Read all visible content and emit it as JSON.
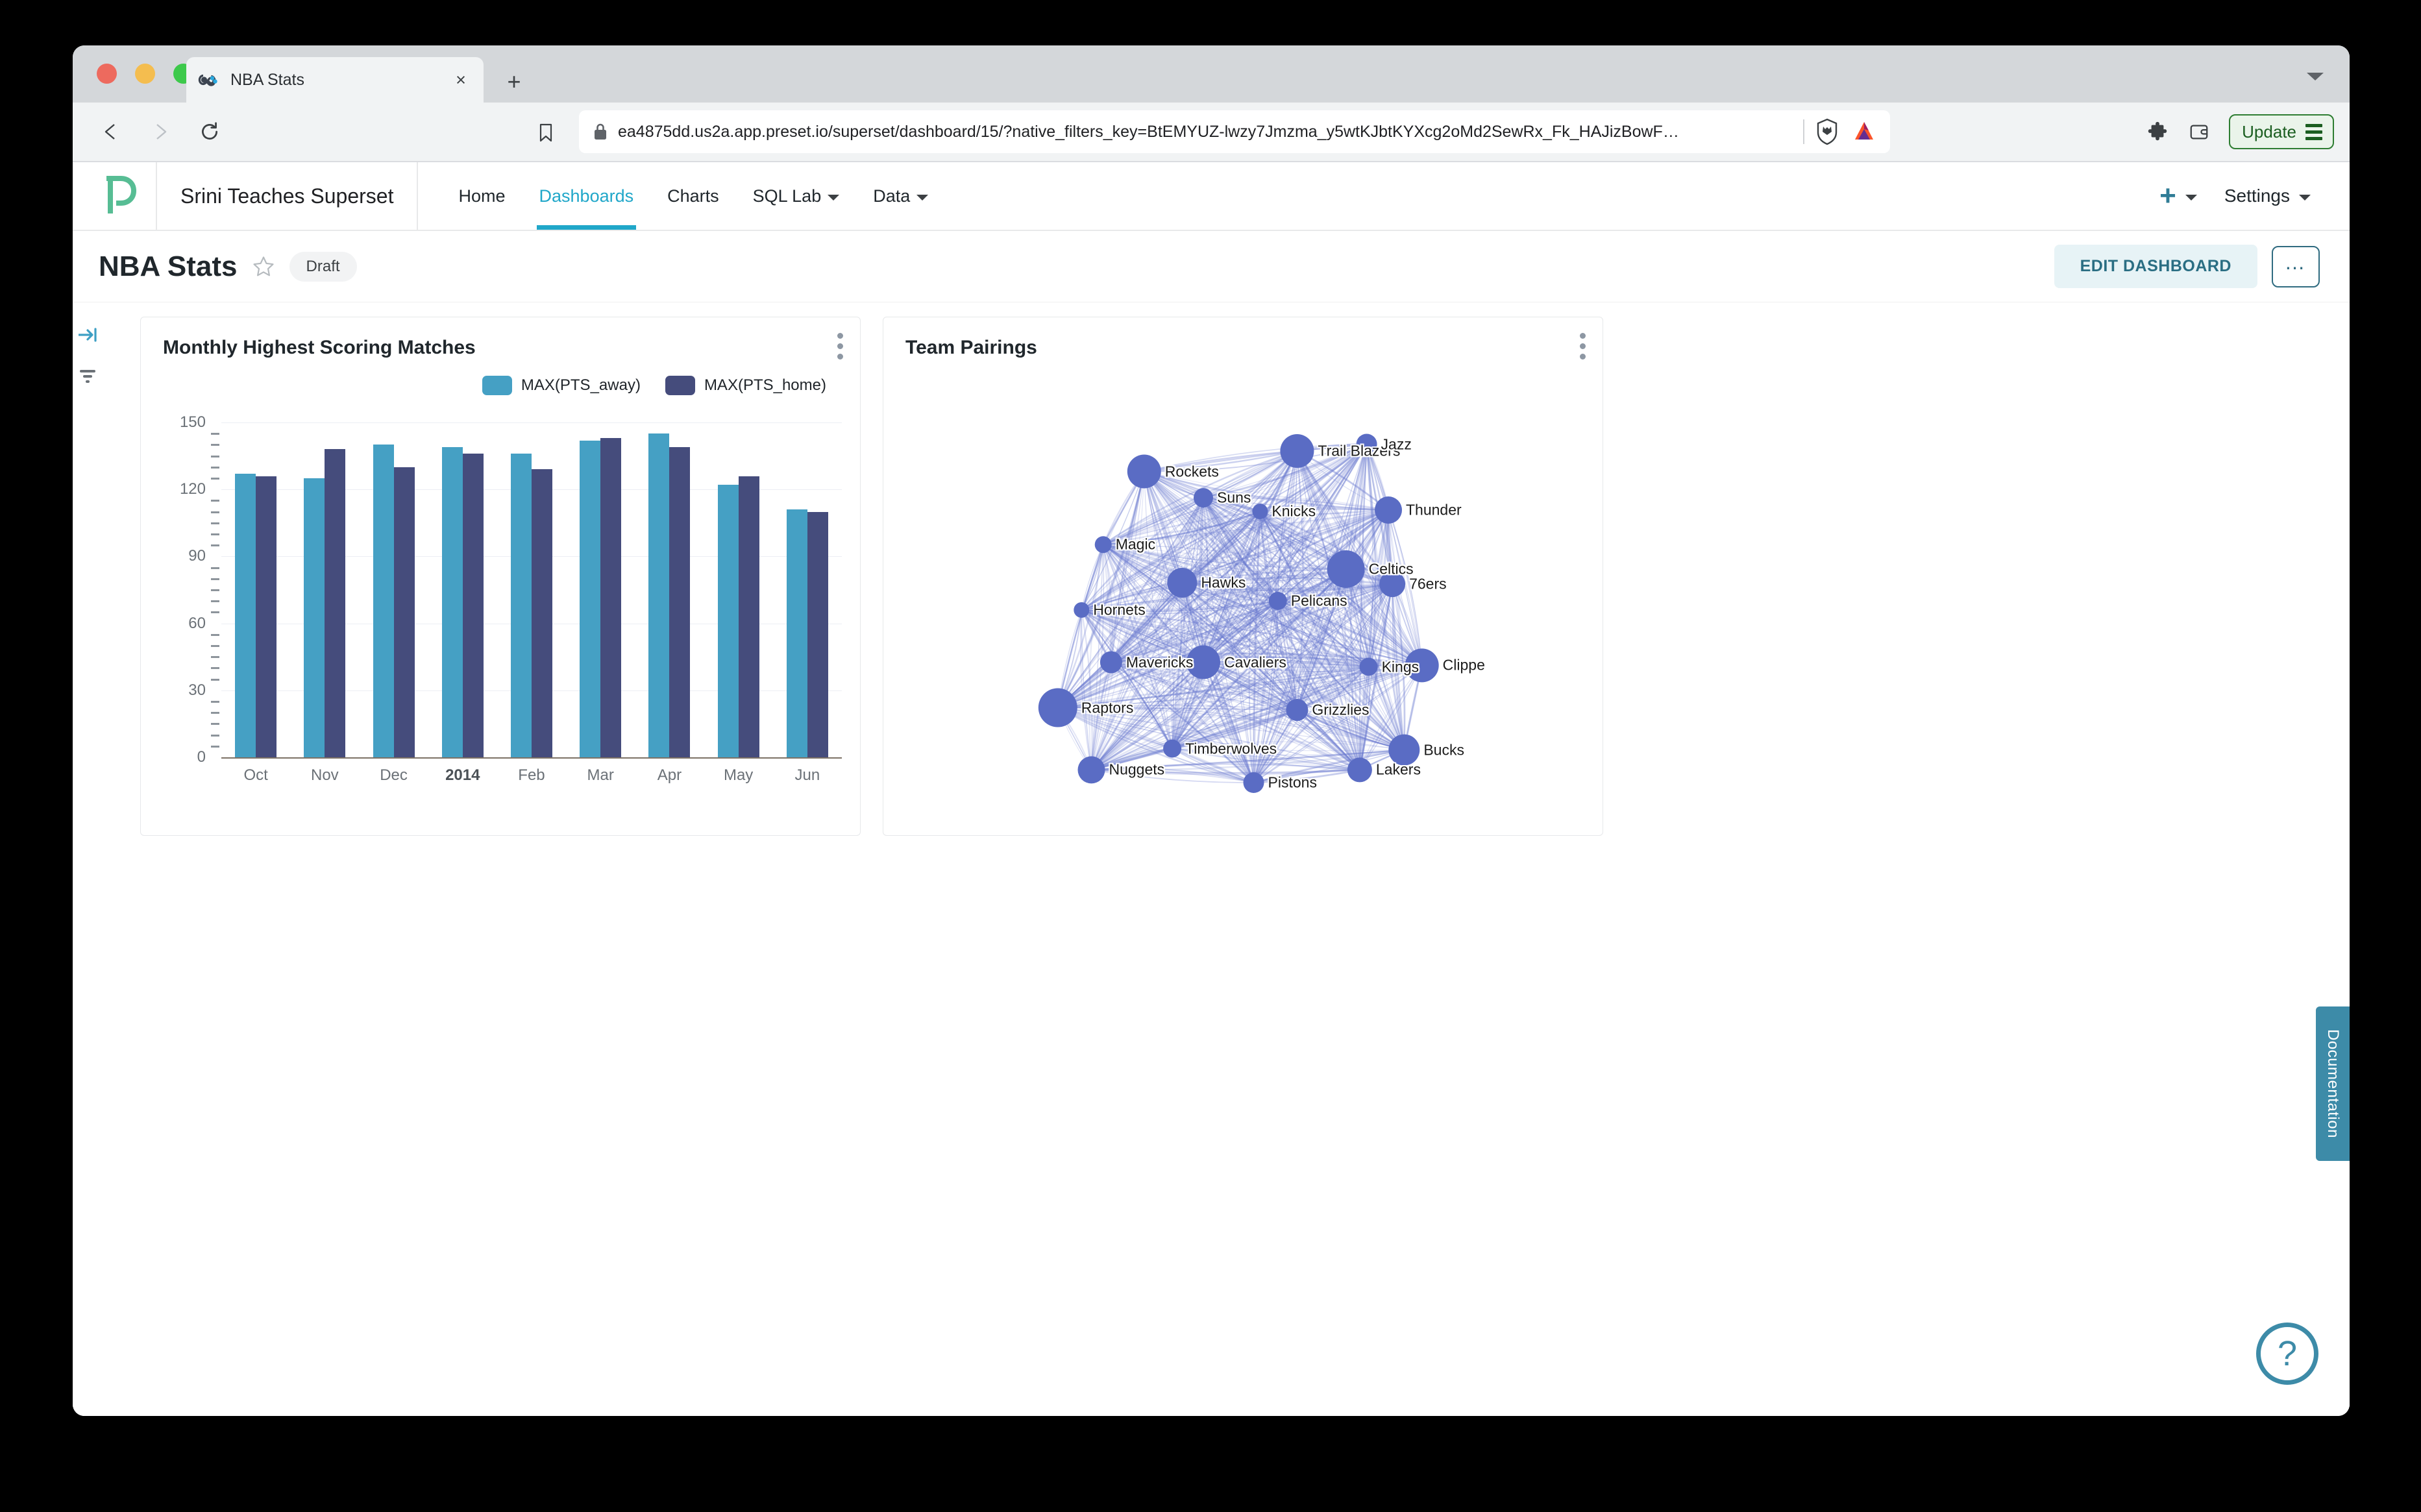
{
  "browser": {
    "tab": {
      "title": "NBA Stats",
      "favicon": "infinity-icon",
      "close": "×"
    },
    "new_tab": "+",
    "url": "ea4875dd.us2a.app.preset.io/superset/dashboard/15/?native_filters_key=BtEMYUZ-lwzy7Jmzma_y5wtKJbtKYXcg2oMd2SewRx_Fk_HAJizBowF…",
    "update_button": "Update",
    "icons": {
      "back": "back-arrow-icon",
      "forward": "forward-arrow-icon",
      "reload": "reload-icon",
      "bookmark": "bookmark-icon",
      "lock": "lock-icon",
      "brave_shield": "brave-lion-icon",
      "bat": "bat-triangle-icon",
      "extensions": "puzzle-icon",
      "wallet": "wallet-icon"
    }
  },
  "navbar": {
    "logo": "preset-logo",
    "workspace": "Srini Teaches Superset",
    "links": [
      {
        "label": "Home",
        "active": false,
        "caret": false
      },
      {
        "label": "Dashboards",
        "active": true,
        "caret": false
      },
      {
        "label": "Charts",
        "active": false,
        "caret": false
      },
      {
        "label": "SQL Lab",
        "active": false,
        "caret": true
      },
      {
        "label": "Data",
        "active": false,
        "caret": true
      }
    ],
    "plus": "+",
    "settings": "Settings",
    "accent": "#20a7c9"
  },
  "dashboard_header": {
    "title": "NBA Stats",
    "favorite_icon": "star-icon",
    "status_badge": "Draft",
    "edit_button": "EDIT DASHBOARD",
    "more_button": "…"
  },
  "left_rail": {
    "expand_icon": "expand-right-icon",
    "filter_icon": "filter-icon"
  },
  "side_tab": {
    "label": "Documentation",
    "color": "#3d8ba8"
  },
  "help_fab": {
    "glyph": "?",
    "name": "help-icon"
  },
  "cards": [
    {
      "title": "Monthly Highest Scoring Matches",
      "menu": "kebab-icon"
    },
    {
      "title": "Team Pairings",
      "menu": "kebab-icon"
    }
  ],
  "chart_data": [
    {
      "type": "bar",
      "title": "Monthly Highest Scoring Matches",
      "xlabel": "",
      "ylabel": "",
      "ylim": [
        0,
        150
      ],
      "yticks": [
        0,
        30,
        60,
        90,
        120,
        150
      ],
      "grid": true,
      "legend_position": "top-right",
      "categories": [
        "Oct",
        "Nov",
        "Dec",
        "2014",
        "Feb",
        "Mar",
        "Apr",
        "May",
        "Jun"
      ],
      "bold_categories": [
        "2014"
      ],
      "series": [
        {
          "name": "MAX(PTS_away)",
          "color": "#45a0c4",
          "values": [
            127,
            125,
            140,
            139,
            136,
            142,
            145,
            122,
            111
          ]
        },
        {
          "name": "MAX(PTS_home)",
          "color": "#454c7c",
          "values": [
            126,
            138,
            130,
            136,
            129,
            143,
            139,
            126,
            110
          ]
        }
      ]
    },
    {
      "type": "graph",
      "title": "Team Pairings",
      "node_color": "#5a6cc4",
      "edge_color": "#6b7bd0",
      "nodes": [
        {
          "label": "Rockets",
          "x": 0.305,
          "y": 0.205,
          "r": 26
        },
        {
          "label": "Trail Blazers",
          "x": 0.615,
          "y": 0.16,
          "r": 26
        },
        {
          "label": "Jazz",
          "x": 0.756,
          "y": 0.145,
          "r": 16
        },
        {
          "label": "Suns",
          "x": 0.425,
          "y": 0.263,
          "r": 15
        },
        {
          "label": "Knicks",
          "x": 0.54,
          "y": 0.293,
          "r": 12
        },
        {
          "label": "Thunder",
          "x": 0.8,
          "y": 0.29,
          "r": 21
        },
        {
          "label": "Magic",
          "x": 0.222,
          "y": 0.366,
          "r": 13
        },
        {
          "label": "Celtics",
          "x": 0.714,
          "y": 0.42,
          "r": 29
        },
        {
          "label": "76ers",
          "x": 0.808,
          "y": 0.453,
          "r": 20
        },
        {
          "label": "Hawks",
          "x": 0.382,
          "y": 0.45,
          "r": 23
        },
        {
          "label": "Pelicans",
          "x": 0.576,
          "y": 0.49,
          "r": 14
        },
        {
          "label": "Hornets",
          "x": 0.178,
          "y": 0.51,
          "r": 12
        },
        {
          "label": "Cavaliers",
          "x": 0.425,
          "y": 0.625,
          "r": 26
        },
        {
          "label": "Mavericks",
          "x": 0.238,
          "y": 0.625,
          "r": 17
        },
        {
          "label": "Kings",
          "x": 0.76,
          "y": 0.635,
          "r": 14
        },
        {
          "label": "Clippe",
          "x": 0.868,
          "y": 0.632,
          "r": 26
        },
        {
          "label": "Raptors",
          "x": 0.13,
          "y": 0.725,
          "r": 30
        },
        {
          "label": "Grizzlies",
          "x": 0.615,
          "y": 0.73,
          "r": 17
        },
        {
          "label": "Timberwolves",
          "x": 0.362,
          "y": 0.815,
          "r": 14
        },
        {
          "label": "Bucks",
          "x": 0.832,
          "y": 0.818,
          "r": 24
        },
        {
          "label": "Nuggets",
          "x": 0.198,
          "y": 0.862,
          "r": 21
        },
        {
          "label": "Lakers",
          "x": 0.742,
          "y": 0.862,
          "r": 19
        },
        {
          "label": "Pistons",
          "x": 0.527,
          "y": 0.89,
          "r": 16
        }
      ]
    }
  ]
}
